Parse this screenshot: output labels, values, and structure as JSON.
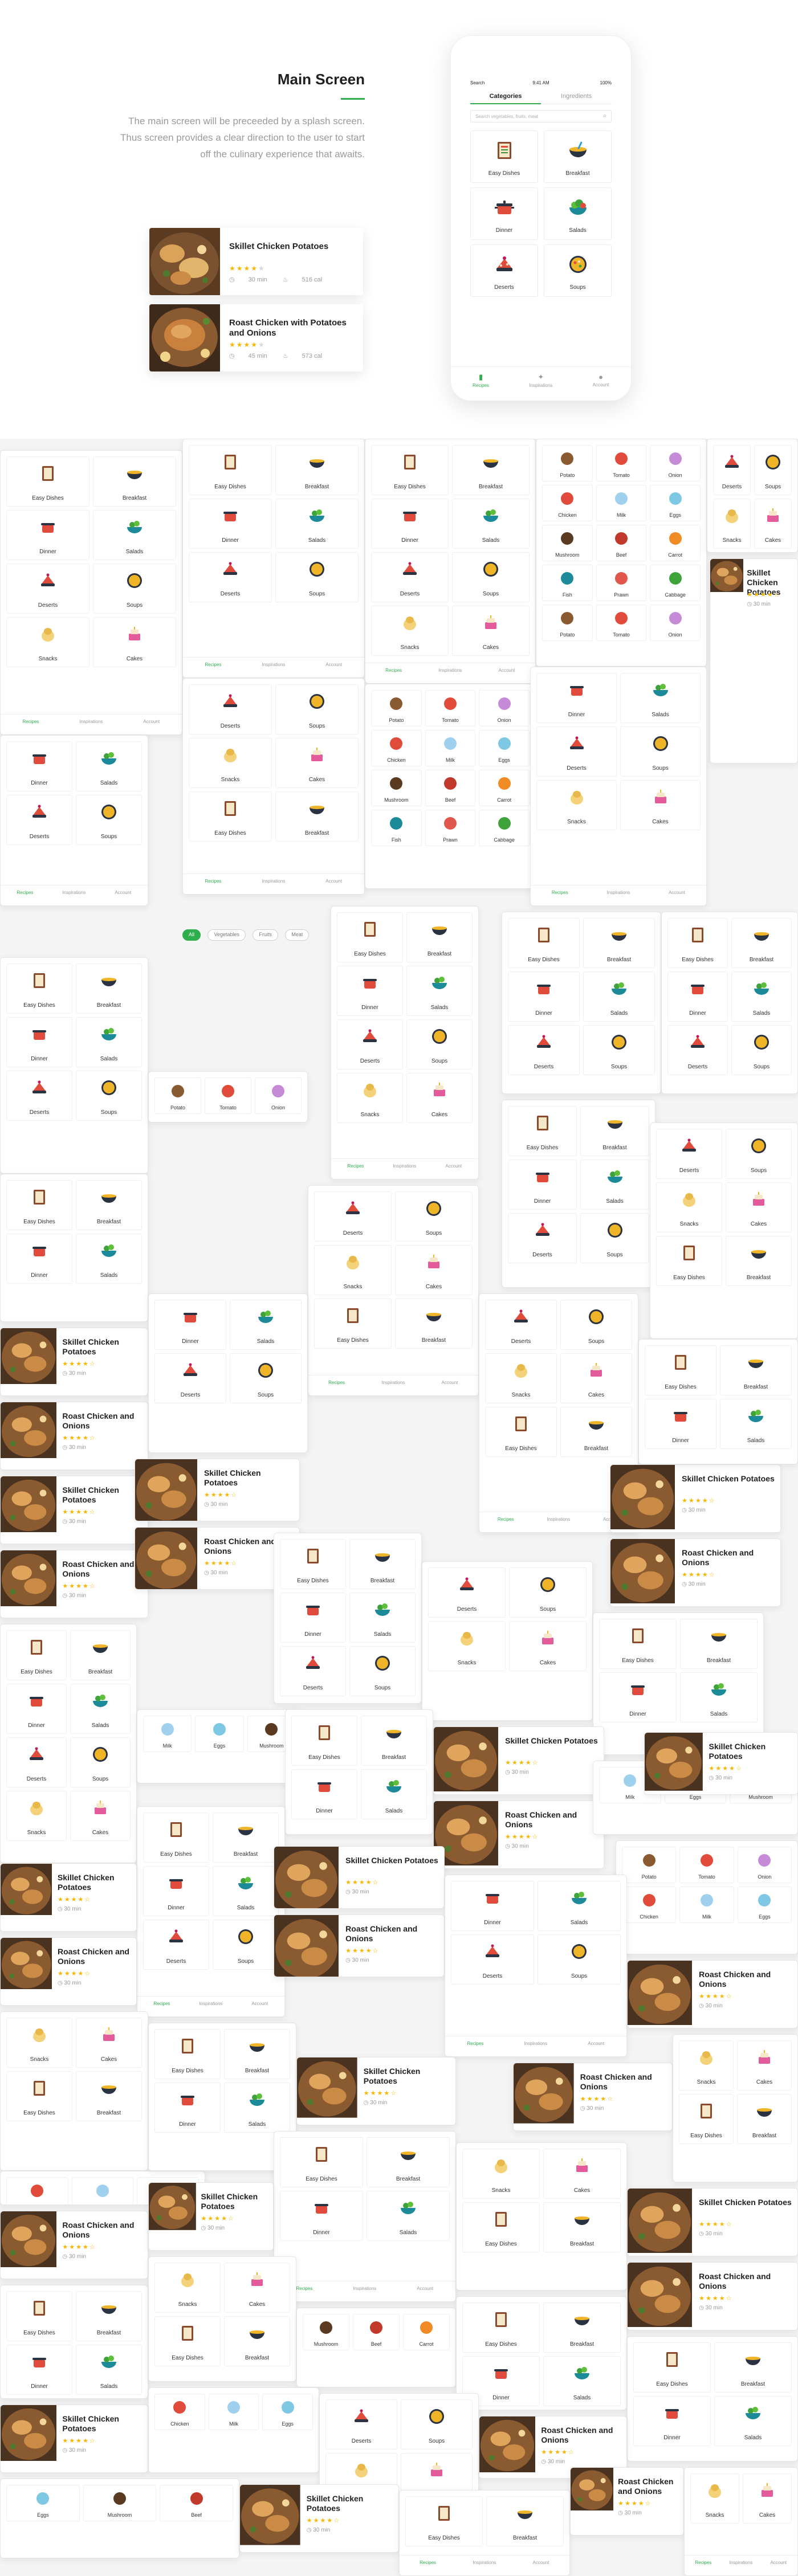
{
  "intro": {
    "title": "Main Screen",
    "description": "The main screen will be preceeded by a splash screen. Thus screen provides a clear direction to the user to start off the culinary experience that awaits."
  },
  "recipes": [
    {
      "title": "Skillet Chicken Potatoes",
      "rating": 4,
      "time": "30 min",
      "calories": "516 cal"
    },
    {
      "title": "Roast Chicken with Potatoes and Onions",
      "rating": 4,
      "time": "45 min",
      "calories": "573 cal"
    }
  ],
  "phone": {
    "status": {
      "carrier": "Search",
      "time": "9:41 AM",
      "battery": "100%"
    },
    "tabs": [
      "Categories",
      "Ingredients"
    ],
    "search_placeholder": "Search vegetables, fruits, meat",
    "categories": [
      "Easy Dishes",
      "Breakfast",
      "Dinner",
      "Salads",
      "Deserts",
      "Soups"
    ],
    "nav": [
      "Recipes",
      "Inspirations",
      "Account"
    ]
  },
  "collage": {
    "categories": [
      "Easy Dishes",
      "Breakfast",
      "Dinner",
      "Salads",
      "Deserts",
      "Soups",
      "Snacks",
      "Cakes"
    ],
    "ingredients": [
      "Potato",
      "Tomato",
      "Onion",
      "Chicken",
      "Milk",
      "Eggs",
      "Mushroom",
      "Beef",
      "Carrot",
      "Fish",
      "Prawn",
      "Cabbage"
    ],
    "nav": [
      "Recipes",
      "Inspirations",
      "Account"
    ],
    "filters": [
      "All",
      "Vegetables",
      "Fruits",
      "Meat"
    ],
    "food_titles": [
      "Skillet Chicken Potatoes",
      "Roast Chicken and Onions"
    ],
    "food_time": "30 min"
  },
  "colors": {
    "accent": "#2fae4d",
    "star": "#f5b700",
    "muted": "#9a9a9a"
  }
}
